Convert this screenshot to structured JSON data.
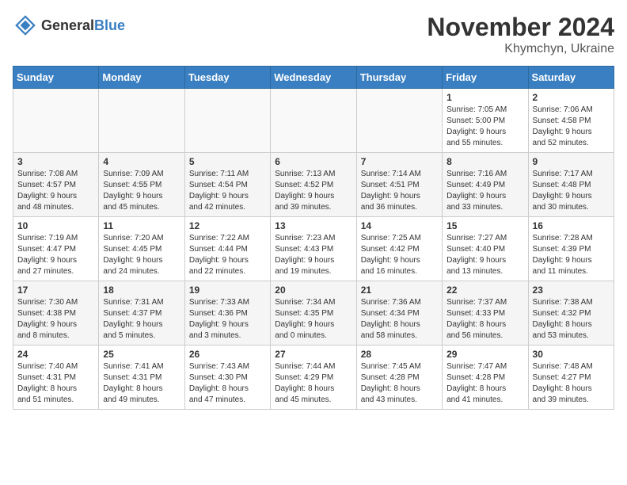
{
  "logo": {
    "text_general": "General",
    "text_blue": "Blue"
  },
  "title": {
    "month": "November 2024",
    "location": "Khymchyn, Ukraine"
  },
  "days_of_week": [
    "Sunday",
    "Monday",
    "Tuesday",
    "Wednesday",
    "Thursday",
    "Friday",
    "Saturday"
  ],
  "weeks": [
    [
      {
        "day": "",
        "info": ""
      },
      {
        "day": "",
        "info": ""
      },
      {
        "day": "",
        "info": ""
      },
      {
        "day": "",
        "info": ""
      },
      {
        "day": "",
        "info": ""
      },
      {
        "day": "1",
        "info": "Sunrise: 7:05 AM\nSunset: 5:00 PM\nDaylight: 9 hours\nand 55 minutes."
      },
      {
        "day": "2",
        "info": "Sunrise: 7:06 AM\nSunset: 4:58 PM\nDaylight: 9 hours\nand 52 minutes."
      }
    ],
    [
      {
        "day": "3",
        "info": "Sunrise: 7:08 AM\nSunset: 4:57 PM\nDaylight: 9 hours\nand 48 minutes."
      },
      {
        "day": "4",
        "info": "Sunrise: 7:09 AM\nSunset: 4:55 PM\nDaylight: 9 hours\nand 45 minutes."
      },
      {
        "day": "5",
        "info": "Sunrise: 7:11 AM\nSunset: 4:54 PM\nDaylight: 9 hours\nand 42 minutes."
      },
      {
        "day": "6",
        "info": "Sunrise: 7:13 AM\nSunset: 4:52 PM\nDaylight: 9 hours\nand 39 minutes."
      },
      {
        "day": "7",
        "info": "Sunrise: 7:14 AM\nSunset: 4:51 PM\nDaylight: 9 hours\nand 36 minutes."
      },
      {
        "day": "8",
        "info": "Sunrise: 7:16 AM\nSunset: 4:49 PM\nDaylight: 9 hours\nand 33 minutes."
      },
      {
        "day": "9",
        "info": "Sunrise: 7:17 AM\nSunset: 4:48 PM\nDaylight: 9 hours\nand 30 minutes."
      }
    ],
    [
      {
        "day": "10",
        "info": "Sunrise: 7:19 AM\nSunset: 4:47 PM\nDaylight: 9 hours\nand 27 minutes."
      },
      {
        "day": "11",
        "info": "Sunrise: 7:20 AM\nSunset: 4:45 PM\nDaylight: 9 hours\nand 24 minutes."
      },
      {
        "day": "12",
        "info": "Sunrise: 7:22 AM\nSunset: 4:44 PM\nDaylight: 9 hours\nand 22 minutes."
      },
      {
        "day": "13",
        "info": "Sunrise: 7:23 AM\nSunset: 4:43 PM\nDaylight: 9 hours\nand 19 minutes."
      },
      {
        "day": "14",
        "info": "Sunrise: 7:25 AM\nSunset: 4:42 PM\nDaylight: 9 hours\nand 16 minutes."
      },
      {
        "day": "15",
        "info": "Sunrise: 7:27 AM\nSunset: 4:40 PM\nDaylight: 9 hours\nand 13 minutes."
      },
      {
        "day": "16",
        "info": "Sunrise: 7:28 AM\nSunset: 4:39 PM\nDaylight: 9 hours\nand 11 minutes."
      }
    ],
    [
      {
        "day": "17",
        "info": "Sunrise: 7:30 AM\nSunset: 4:38 PM\nDaylight: 9 hours\nand 8 minutes."
      },
      {
        "day": "18",
        "info": "Sunrise: 7:31 AM\nSunset: 4:37 PM\nDaylight: 9 hours\nand 5 minutes."
      },
      {
        "day": "19",
        "info": "Sunrise: 7:33 AM\nSunset: 4:36 PM\nDaylight: 9 hours\nand 3 minutes."
      },
      {
        "day": "20",
        "info": "Sunrise: 7:34 AM\nSunset: 4:35 PM\nDaylight: 9 hours\nand 0 minutes."
      },
      {
        "day": "21",
        "info": "Sunrise: 7:36 AM\nSunset: 4:34 PM\nDaylight: 8 hours\nand 58 minutes."
      },
      {
        "day": "22",
        "info": "Sunrise: 7:37 AM\nSunset: 4:33 PM\nDaylight: 8 hours\nand 56 minutes."
      },
      {
        "day": "23",
        "info": "Sunrise: 7:38 AM\nSunset: 4:32 PM\nDaylight: 8 hours\nand 53 minutes."
      }
    ],
    [
      {
        "day": "24",
        "info": "Sunrise: 7:40 AM\nSunset: 4:31 PM\nDaylight: 8 hours\nand 51 minutes."
      },
      {
        "day": "25",
        "info": "Sunrise: 7:41 AM\nSunset: 4:31 PM\nDaylight: 8 hours\nand 49 minutes."
      },
      {
        "day": "26",
        "info": "Sunrise: 7:43 AM\nSunset: 4:30 PM\nDaylight: 8 hours\nand 47 minutes."
      },
      {
        "day": "27",
        "info": "Sunrise: 7:44 AM\nSunset: 4:29 PM\nDaylight: 8 hours\nand 45 minutes."
      },
      {
        "day": "28",
        "info": "Sunrise: 7:45 AM\nSunset: 4:28 PM\nDaylight: 8 hours\nand 43 minutes."
      },
      {
        "day": "29",
        "info": "Sunrise: 7:47 AM\nSunset: 4:28 PM\nDaylight: 8 hours\nand 41 minutes."
      },
      {
        "day": "30",
        "info": "Sunrise: 7:48 AM\nSunset: 4:27 PM\nDaylight: 8 hours\nand 39 minutes."
      }
    ]
  ]
}
